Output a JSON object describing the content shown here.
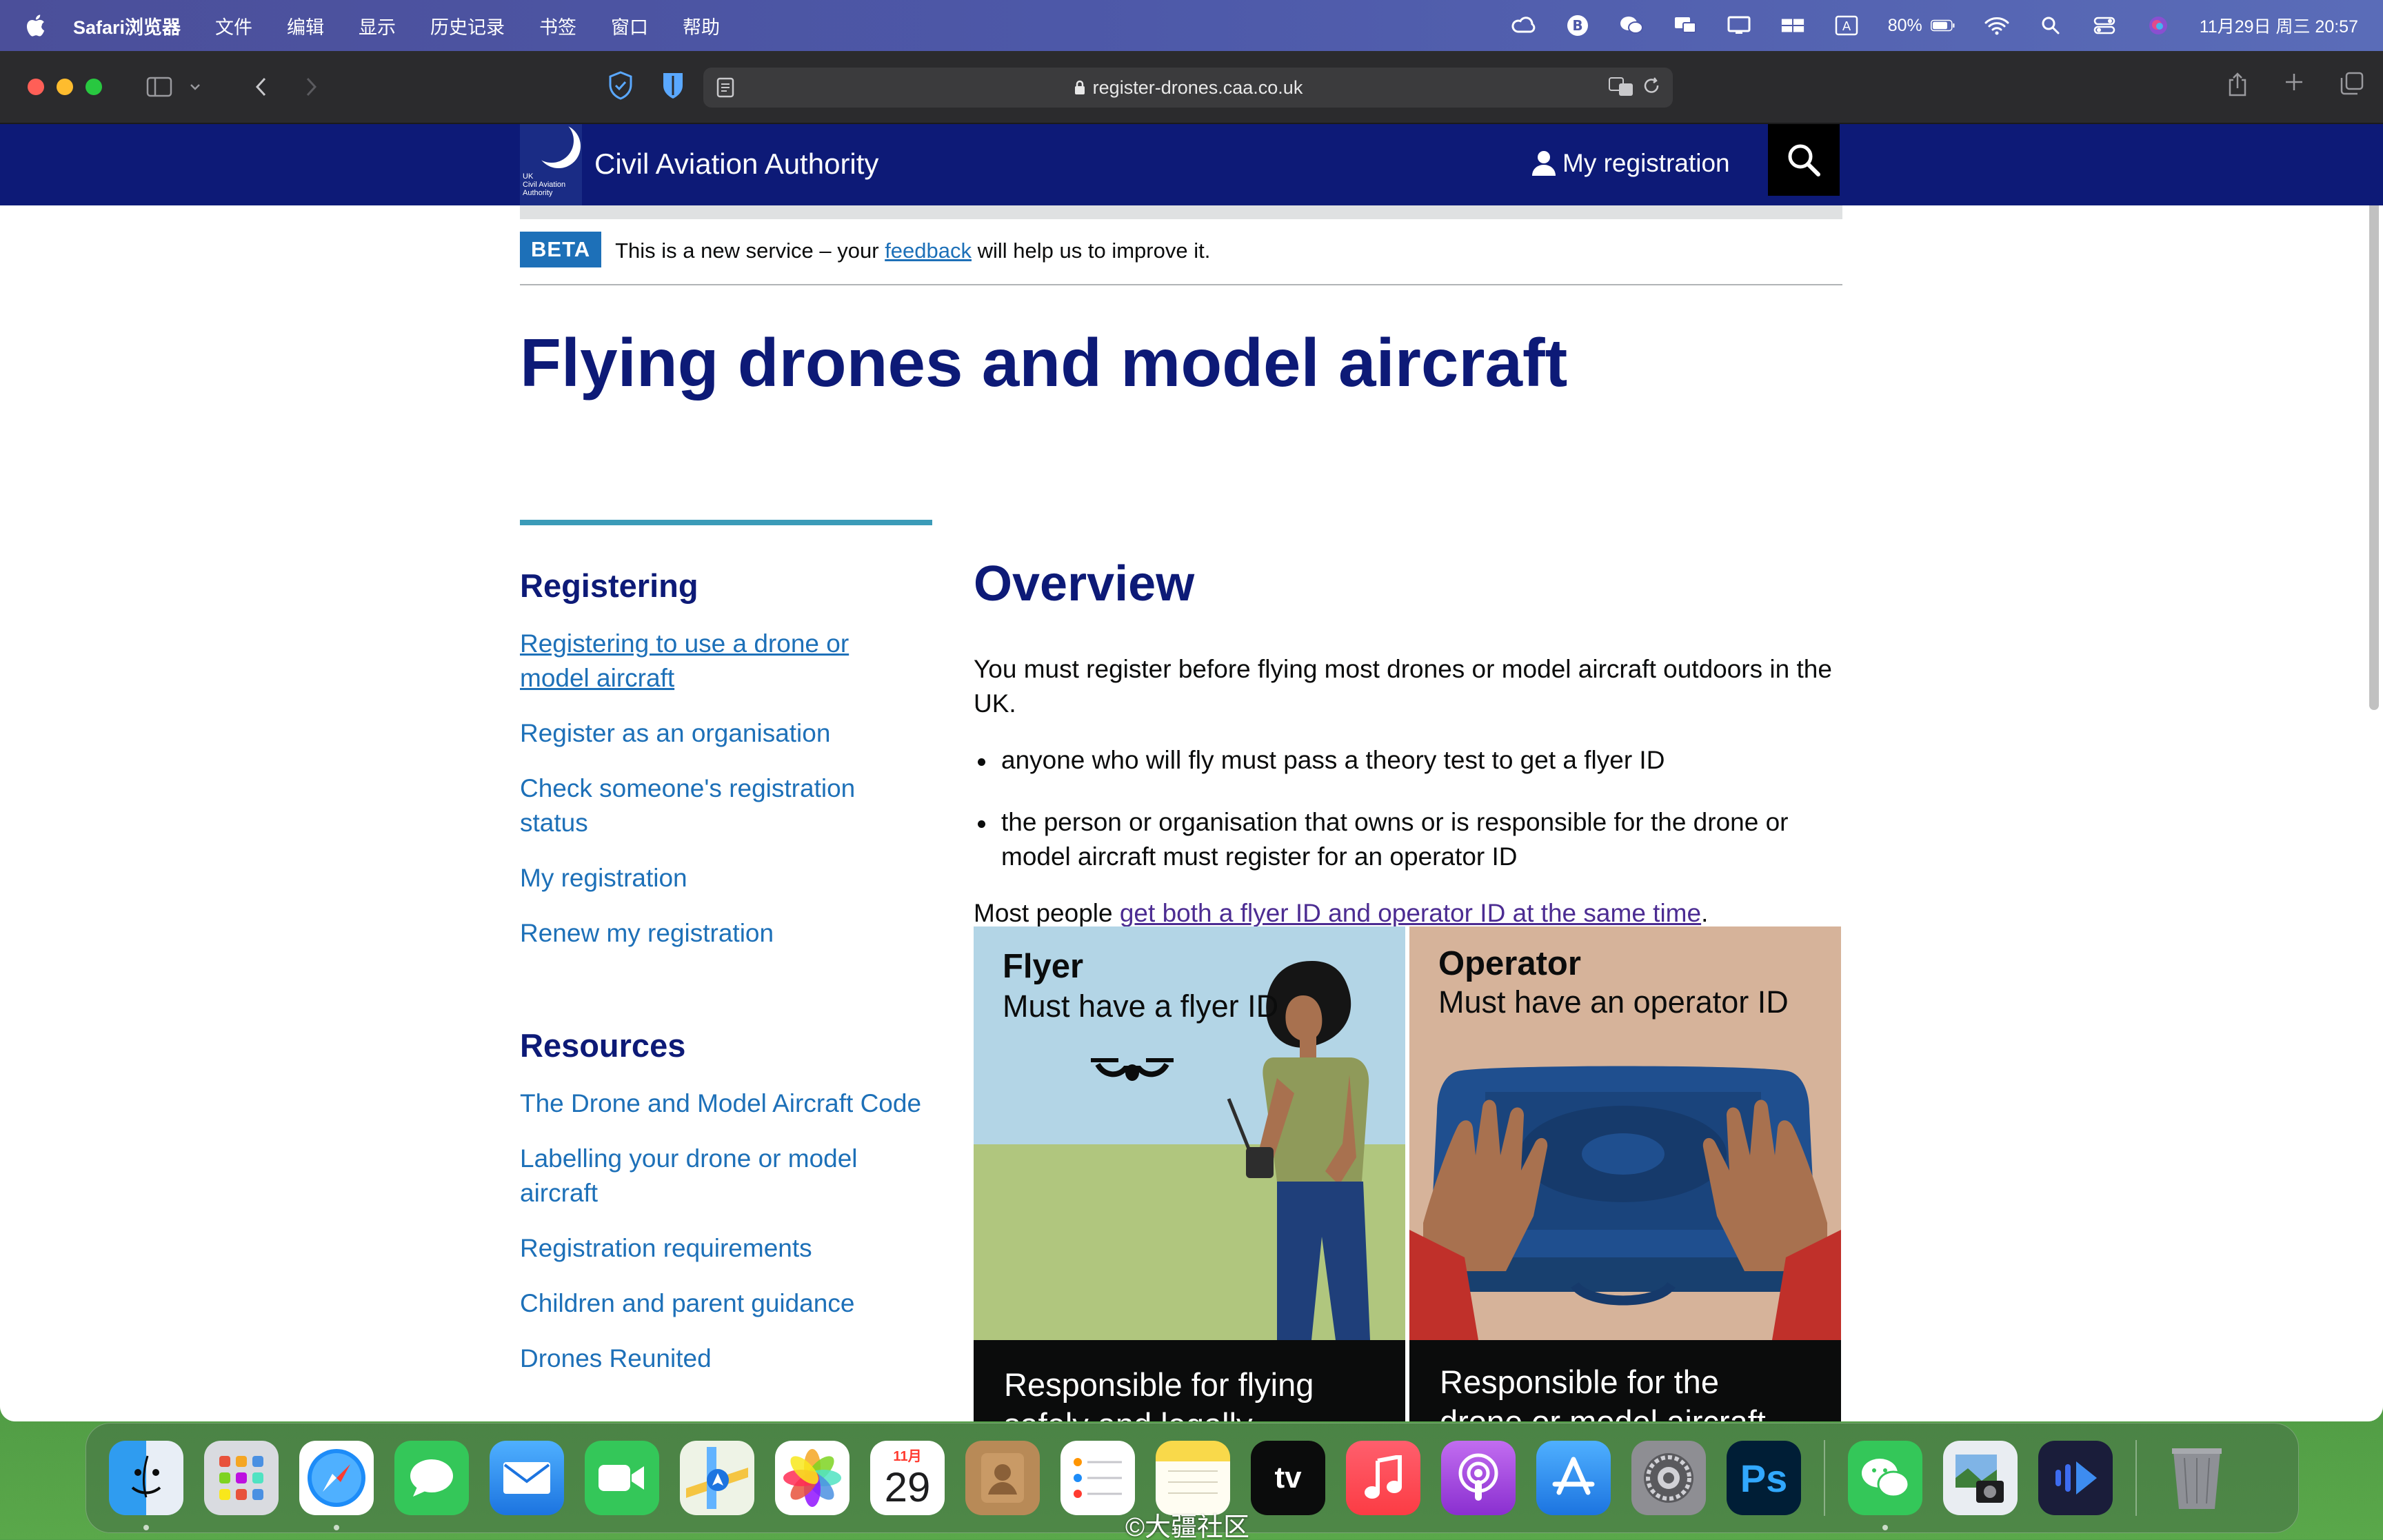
{
  "menubar": {
    "app_name": "Safari浏览器",
    "items": [
      "文件",
      "编辑",
      "显示",
      "历史记录",
      "书签",
      "窗口",
      "帮助"
    ],
    "battery": "80%",
    "datetime": "11月29日 周三  20:57"
  },
  "browser": {
    "url": "register-drones.caa.co.uk"
  },
  "header": {
    "logo_lines": [
      "UK",
      "Civil Aviation",
      "Authority"
    ],
    "site_title": "Civil Aviation Authority",
    "my_registration": "My registration",
    "colors": {
      "header_bg": "#0d1a77",
      "search_bg": "#000000"
    }
  },
  "beta": {
    "tag": "BETA",
    "text_before": "This is a new service – your ",
    "link": "feedback",
    "text_after": " will help us to improve it."
  },
  "page": {
    "title": "Flying drones and model aircraft"
  },
  "sidebar": {
    "registering_heading": "Registering",
    "registering_links": [
      "Registering to use a drone or model aircraft",
      "Register as an organisation",
      "Check someone's registration status",
      "My registration",
      "Renew my registration"
    ],
    "resources_heading": "Resources",
    "resources_links": [
      "The Drone and Model Aircraft Code",
      "Labelling your drone or model aircraft",
      "Registration requirements",
      "Children and parent guidance",
      "Drones Reunited"
    ]
  },
  "main": {
    "heading": "Overview",
    "intro": "You must register before flying most drones or model aircraft outdoors in the UK.",
    "bullets": [
      "anyone who will fly must pass a theory test to get a flyer ID",
      "the person or organisation that owns or is responsible for the drone or model aircraft must register for an operator ID"
    ],
    "most_people_prefix": "Most people ",
    "most_people_link": "get both a flyer ID and operator ID at the same time",
    "most_people_suffix": "."
  },
  "cards": {
    "flyer": {
      "title": "Flyer",
      "subtitle": "Must have a flyer ID",
      "bar_text": "Responsible for flying safely and legally"
    },
    "operator": {
      "title": "Operator",
      "subtitle": "Must have an operator ID",
      "bar_text": "Responsible for the drone or model aircraft, and who"
    }
  },
  "dock": {
    "icons": [
      "finder",
      "launchpad",
      "safari",
      "messages",
      "mail",
      "facetime",
      "maps",
      "photos",
      "calendar",
      "contacts",
      "reminders",
      "notes",
      "apple-tv",
      "music",
      "podcasts",
      "app-store",
      "system-settings",
      "photoshop",
      "wechat",
      "preview",
      "tv-app",
      "trash"
    ],
    "calendar_month": "11月",
    "calendar_day": "29",
    "tv_label": "tv",
    "ps_label": "Ps"
  },
  "watermark": "©大疆社区"
}
